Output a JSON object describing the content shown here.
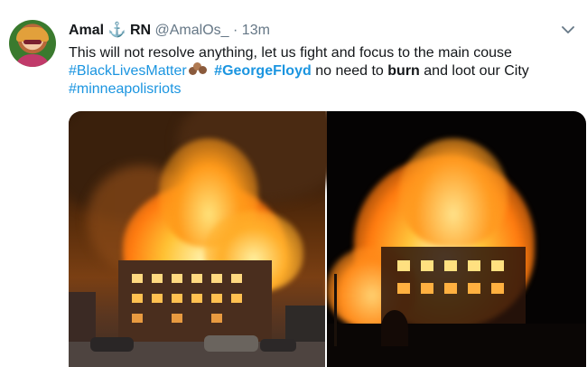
{
  "tweet": {
    "author": {
      "display_name": "Amal",
      "badge_suffix": "RN",
      "handle": "@AmalOs_",
      "separator": "·",
      "timestamp": "13m"
    },
    "text": {
      "line1": "This will not resolve anything, let us fight and focus to the main couse",
      "hashtag1": "#BlackLivesMatter",
      "hashtag2": "#GeorgeFloyd",
      "segment_a": "no need to",
      "bold_word": "burn",
      "segment_b": "and loot our City",
      "hashtag3": "#minneapolisriots"
    },
    "icons": {
      "anchor": "anchor-icon",
      "emoji": "paw-prints-emoji",
      "menu": "chevron-down-icon"
    },
    "media": {
      "count": 2,
      "photos": [
        "photo-burning-building-day",
        "photo-burning-building-night"
      ]
    },
    "colors": {
      "hashtag": "#1b95e0",
      "anchor": "#1b6fc2",
      "text": "#14171a",
      "muted": "#657786"
    }
  }
}
